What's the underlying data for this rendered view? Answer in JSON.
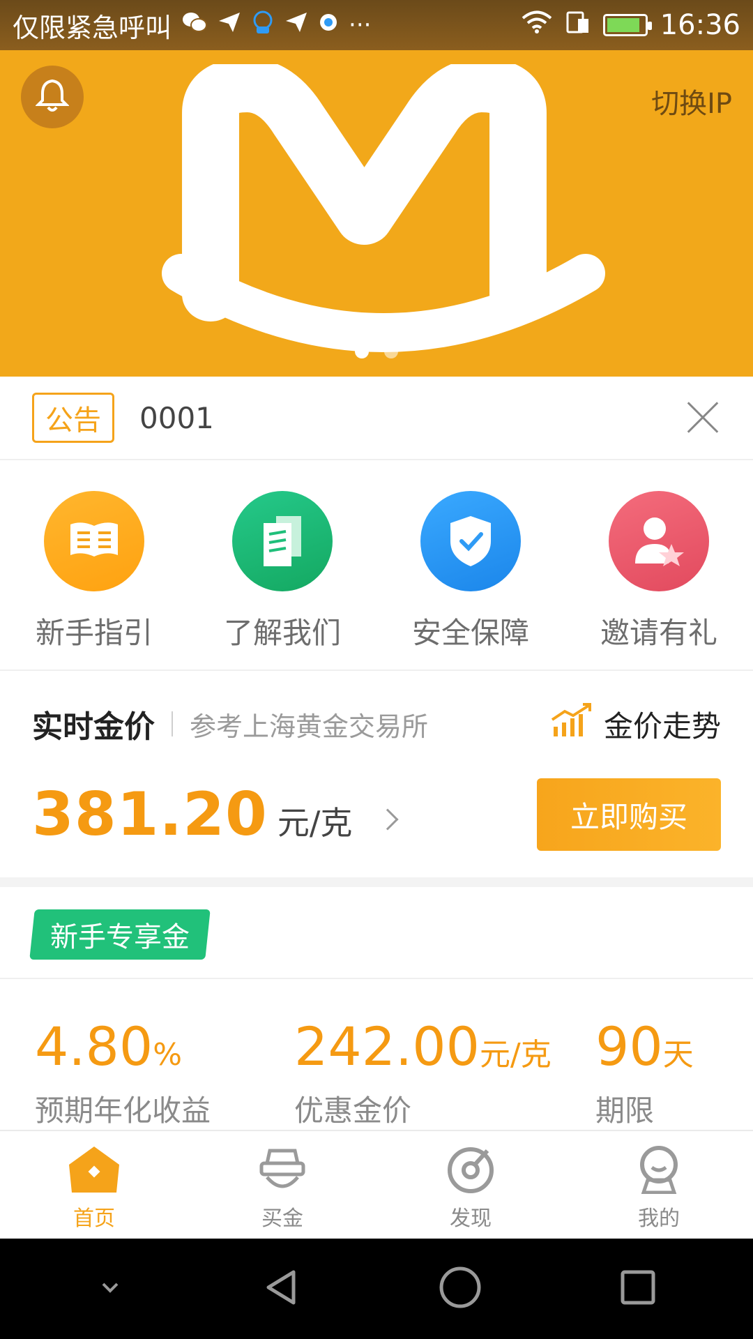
{
  "status_bar": {
    "carrier": "仅限紧急呼叫",
    "time": "16:36",
    "icons": [
      "wechat-icon",
      "send-icon",
      "chat-icon",
      "send-icon",
      "qq-icon",
      "more-icon",
      "wifi-icon",
      "sim-icon",
      "battery-icon"
    ]
  },
  "header": {
    "switch_ip": "切换IP",
    "carousel_count": 2,
    "carousel_active": 1
  },
  "notice": {
    "tag": "公告",
    "text": "0001"
  },
  "quick_menu": [
    {
      "label": "新手指引",
      "icon": "book-icon",
      "color": "#ffac1a"
    },
    {
      "label": "了解我们",
      "icon": "document-icon",
      "color": "#1fbf7a"
    },
    {
      "label": "安全保障",
      "icon": "shield-check-icon",
      "color": "#2f9bf5"
    },
    {
      "label": "邀请有礼",
      "icon": "user-star-icon",
      "color": "#ec5a6c"
    }
  ],
  "gold_price": {
    "title": "实时金价",
    "subtitle": "参考上海黄金交易所",
    "trend_label": "金价走势",
    "price": "381.20",
    "unit": "元/克",
    "buy_label": "立即购买"
  },
  "newbie": {
    "badge": "新手专享金",
    "stats": [
      {
        "value": "4.80",
        "suffix": "%",
        "label": "预期年化收益"
      },
      {
        "value": "242.00",
        "suffix": "元/克",
        "label": "优惠金价"
      },
      {
        "value": "90",
        "suffix": "天",
        "label": "期限"
      }
    ]
  },
  "tabbar": [
    {
      "label": "首页",
      "icon": "home-icon",
      "active": true
    },
    {
      "label": "买金",
      "icon": "shop-icon",
      "active": false
    },
    {
      "label": "发现",
      "icon": "discover-icon",
      "active": false
    },
    {
      "label": "我的",
      "icon": "profile-icon",
      "active": false
    }
  ],
  "colors": {
    "accent": "#f5a31a",
    "green": "#21c17a",
    "banner": "#f2a81a"
  }
}
